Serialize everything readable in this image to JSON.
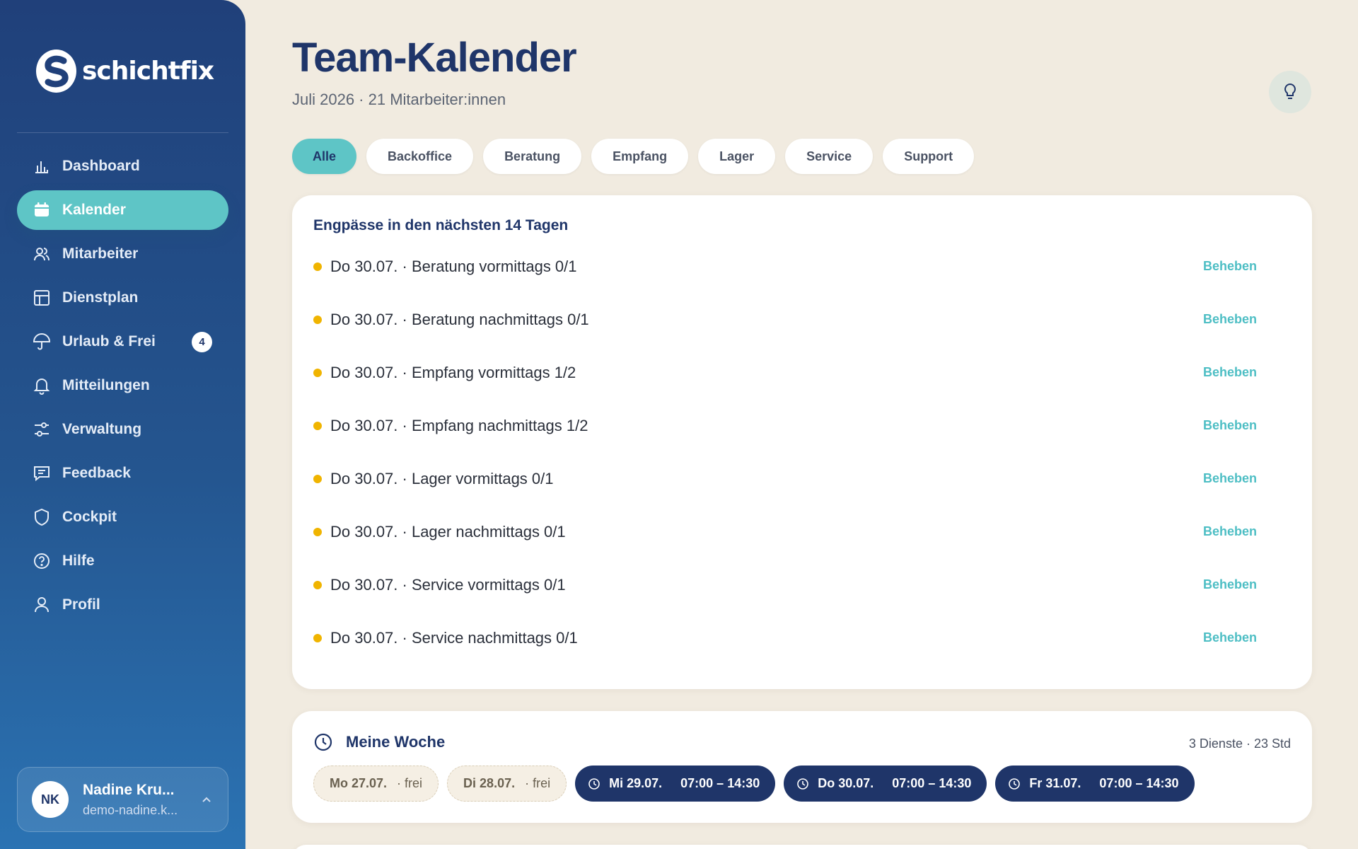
{
  "app": {
    "name": "schichtfix"
  },
  "sidebar": {
    "items": [
      {
        "label": "Dashboard",
        "icon": "bar-chart-icon"
      },
      {
        "label": "Kalender",
        "icon": "calendar-icon",
        "active": true
      },
      {
        "label": "Mitarbeiter",
        "icon": "users-icon"
      },
      {
        "label": "Dienstplan",
        "icon": "layout-icon"
      },
      {
        "label": "Urlaub & Frei",
        "icon": "umbrella-icon",
        "badge": "4"
      },
      {
        "label": "Mitteilungen",
        "icon": "bell-icon"
      },
      {
        "label": "Verwaltung",
        "icon": "sliders-icon"
      },
      {
        "label": "Feedback",
        "icon": "message-icon"
      },
      {
        "label": "Cockpit",
        "icon": "shield-icon"
      },
      {
        "label": "Hilfe",
        "icon": "help-circle-icon"
      },
      {
        "label": "Profil",
        "icon": "user-icon"
      }
    ],
    "user": {
      "initials": "NK",
      "name": "Nadine Kru...",
      "email": "demo-nadine.k..."
    }
  },
  "header": {
    "title": "Team-Kalender",
    "subtitle": "Juli 2026 · 21 Mitarbeiter:innen"
  },
  "filters": [
    "Alle",
    "Backoffice",
    "Beratung",
    "Empfang",
    "Lager",
    "Service",
    "Support"
  ],
  "shortages": {
    "title": "Engpässe in den nächsten 14 Tagen",
    "action_label": "Beheben",
    "rows": [
      "Do 30.07. · Beratung vormittags 0/1",
      "Do 30.07. · Beratung nachmittags 0/1",
      "Do 30.07. · Empfang vormittags 1/2",
      "Do 30.07. · Empfang nachmittags 1/2",
      "Do 30.07. · Lager vormittags 0/1",
      "Do 30.07. · Lager nachmittags 0/1",
      "Do 30.07. · Service vormittags 0/1",
      "Do 30.07. · Service nachmittags 0/1"
    ]
  },
  "week": {
    "title": "Meine Woche",
    "summary": "3 Dienste · 23 Std",
    "days": [
      {
        "day": "Mo 27.07.",
        "note": "· frei"
      },
      {
        "day": "Di 28.07.",
        "note": "· frei"
      },
      {
        "day": "Mi 29.07.",
        "time": "07:00 – 14:30"
      },
      {
        "day": "Do 30.07.",
        "time": "07:00 – 14:30"
      },
      {
        "day": "Fr 31.07.",
        "time": "07:00 – 14:30"
      }
    ]
  },
  "colors": {
    "accent": "#5ec5c6",
    "navy": "#1f3569",
    "warning": "#f0b400",
    "background": "#f1ebe0"
  }
}
